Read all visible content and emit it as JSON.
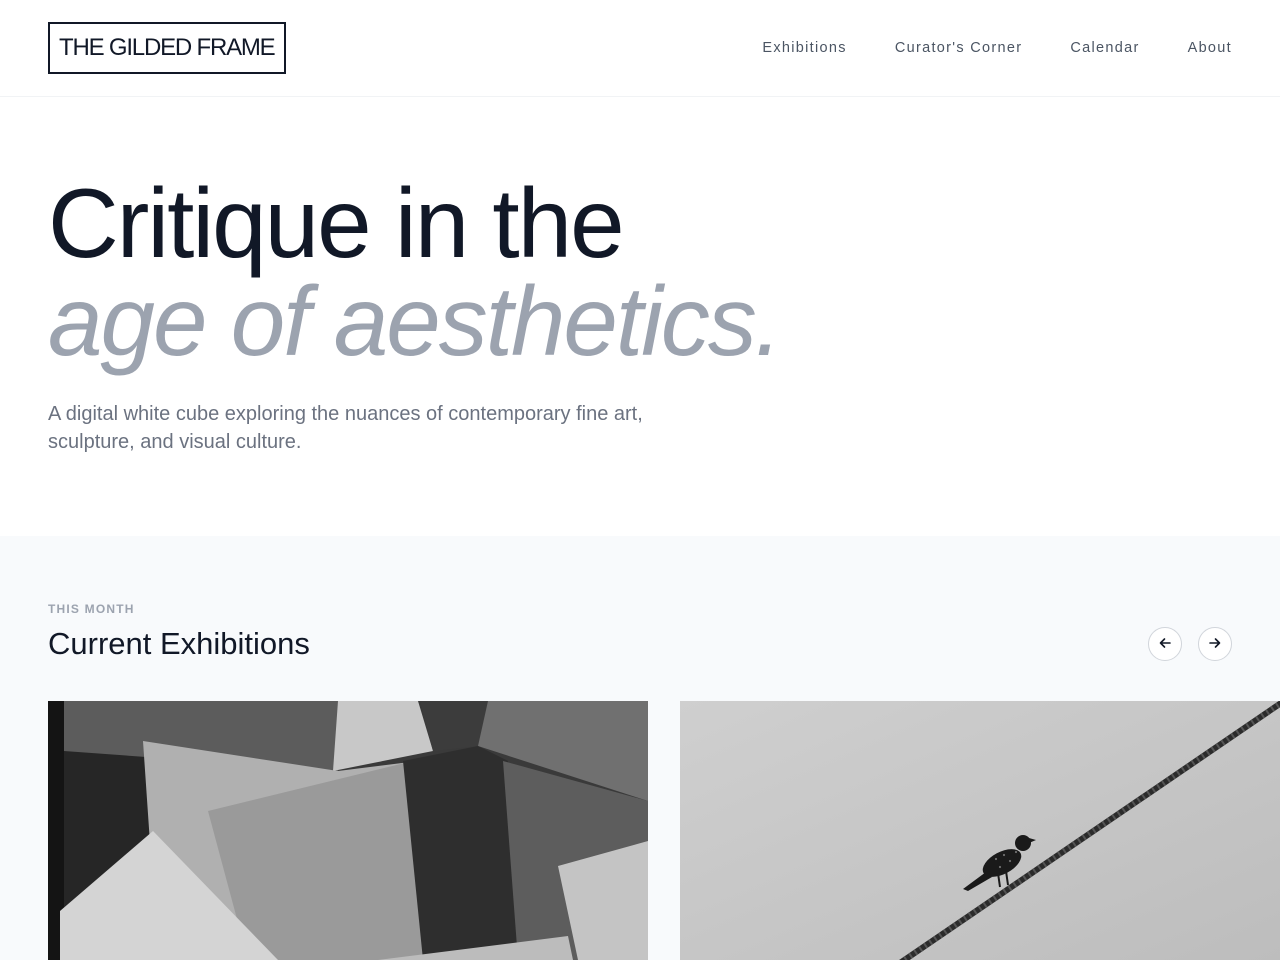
{
  "header": {
    "logo": "THE GILDED FRAME",
    "nav": [
      {
        "label": "Exhibitions"
      },
      {
        "label": "Curator's Corner"
      },
      {
        "label": "Calendar"
      },
      {
        "label": "About"
      }
    ]
  },
  "hero": {
    "title_line1": "Critique in the",
    "title_line2": "age of aesthetics.",
    "subtitle": "A digital white cube exploring the nuances of contemporary fine art, sculpture, and visual culture."
  },
  "exhibitions": {
    "eyebrow": "THIS MONTH",
    "title": "Current Exhibitions",
    "prev_icon": "arrow-left-icon",
    "next_icon": "arrow-right-icon",
    "cards": [
      {
        "image": "abstract-paper-shapes-image"
      },
      {
        "image": "bird-on-wire-image"
      }
    ]
  },
  "colors": {
    "text_dark": "#111827",
    "text_muted": "#9ca3af",
    "nav_text": "#4b5563",
    "section_bg": "#f8fafc"
  }
}
